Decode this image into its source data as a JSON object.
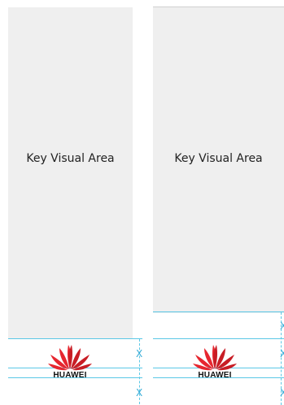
{
  "left_panel": {
    "label": "Key Visual Area"
  },
  "right_panel": {
    "label": "Key Visual Area"
  },
  "spacing_marker": "X",
  "logo": {
    "text": "HUAWEI",
    "colors": [
      "#e6262f",
      "#c81d25"
    ]
  },
  "guide_color": "#5bc8e6"
}
